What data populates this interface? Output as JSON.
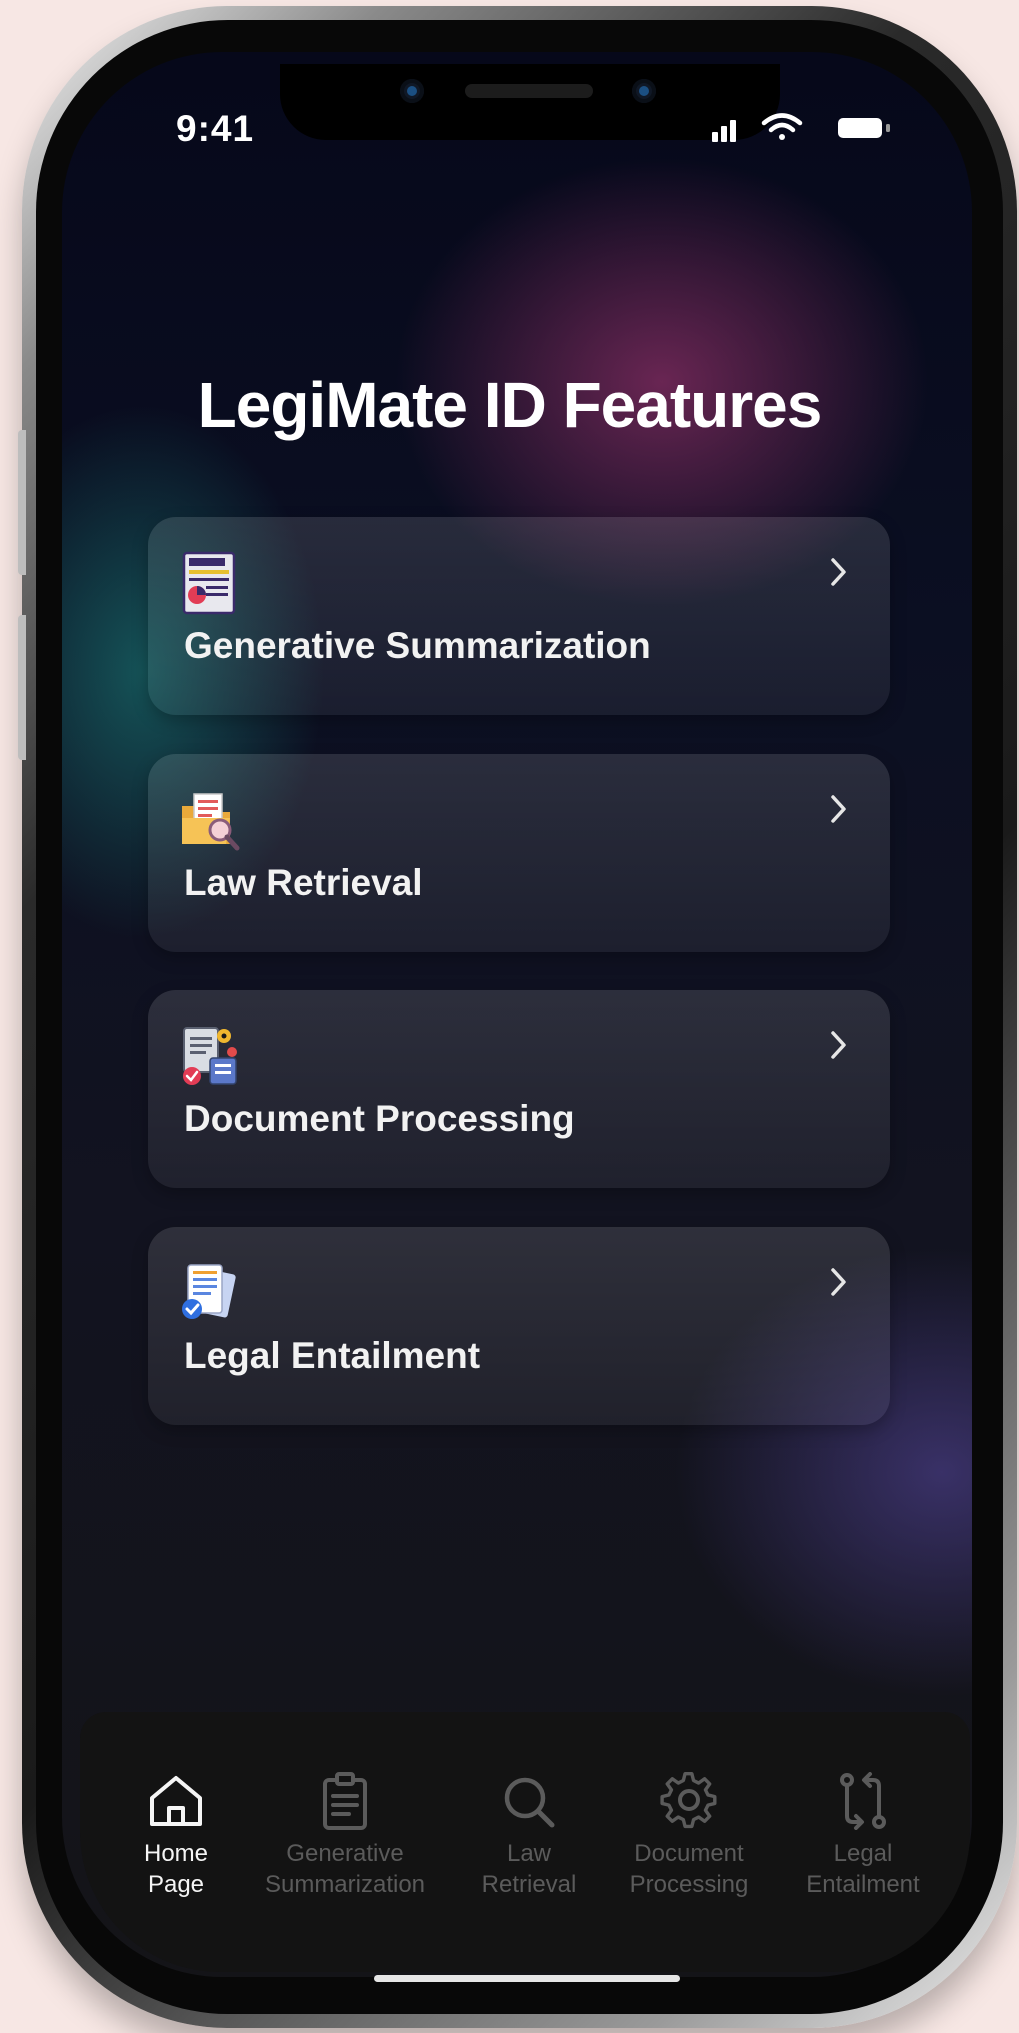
{
  "status_bar": {
    "time": "9:41"
  },
  "header": {
    "title": "LegiMate ID Features"
  },
  "features": [
    {
      "label": "Generative Summarization",
      "icon": "summary-document-icon"
    },
    {
      "label": "Law Retrieval",
      "icon": "folder-search-icon"
    },
    {
      "label": "Document Processing",
      "icon": "document-gear-icon"
    },
    {
      "label": "Legal Entailment",
      "icon": "documents-check-icon"
    }
  ],
  "tabbar": {
    "items": [
      {
        "label": "Home\nPage",
        "icon": "home-icon",
        "active": true
      },
      {
        "label": "Generative\nSummarization",
        "icon": "clipboard-icon",
        "active": false
      },
      {
        "label": "Law\nRetrieval",
        "icon": "search-icon",
        "active": false
      },
      {
        "label": "Document\nProcessing",
        "icon": "gear-icon",
        "active": false
      },
      {
        "label": "Legal\nEntailment",
        "icon": "git-compare-icon",
        "active": false
      }
    ]
  },
  "colors": {
    "background": "#f7e7e4",
    "active_tab": "#f5f5f5",
    "inactive_tab": "#5b5b5b",
    "text": "#ffffff"
  }
}
